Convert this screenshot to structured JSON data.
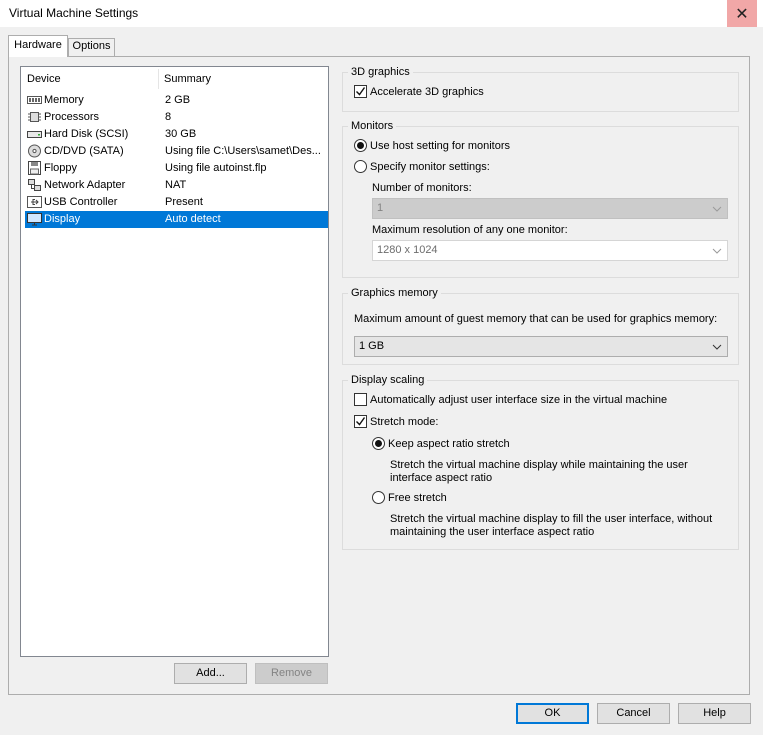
{
  "window": {
    "title": "Virtual Machine Settings"
  },
  "tabs": [
    {
      "label": "Hardware",
      "active": true
    },
    {
      "label": "Options",
      "active": false
    }
  ],
  "device_list": {
    "columns": [
      "Device",
      "Summary"
    ],
    "rows": [
      {
        "device": "Memory",
        "summary": "2 GB",
        "icon": "memory-icon"
      },
      {
        "device": "Processors",
        "summary": "8",
        "icon": "processor-icon"
      },
      {
        "device": "Hard Disk (SCSI)",
        "summary": "30 GB",
        "icon": "hard-disk-icon"
      },
      {
        "device": "CD/DVD (SATA)",
        "summary": "Using file C:\\Users\\samet\\Des...",
        "icon": "cd-dvd-icon"
      },
      {
        "device": "Floppy",
        "summary": "Using file autoinst.flp",
        "icon": "floppy-icon"
      },
      {
        "device": "Network Adapter",
        "summary": "NAT",
        "icon": "network-adapter-icon"
      },
      {
        "device": "USB Controller",
        "summary": "Present",
        "icon": "usb-icon"
      },
      {
        "device": "Display",
        "summary": "Auto detect",
        "icon": "display-icon",
        "selected": true
      }
    ],
    "add_label": "Add...",
    "remove_label": "Remove"
  },
  "graphics3d": {
    "group": "3D graphics",
    "accelerate_label": "Accelerate 3D graphics",
    "accelerate_checked": true
  },
  "monitors": {
    "group": "Monitors",
    "use_host_label": "Use host setting for monitors",
    "specify_label": "Specify monitor settings:",
    "selected": "use_host",
    "num_label": "Number of monitors:",
    "num_value": "1",
    "res_label": "Maximum resolution of any one monitor:",
    "res_value": "1280 x 1024"
  },
  "graphics_memory": {
    "group": "Graphics memory",
    "desc": "Maximum amount of guest memory that can be used for graphics memory:",
    "value": "1 GB"
  },
  "display_scaling": {
    "group": "Display scaling",
    "auto_adjust_label": "Automatically adjust user interface size in the virtual machine",
    "auto_adjust_checked": false,
    "stretch_label": "Stretch mode:",
    "stretch_checked": true,
    "keep_label": "Keep aspect ratio stretch",
    "keep_desc_1": "Stretch the virtual machine display while maintaining the user",
    "keep_desc_2": "interface aspect ratio",
    "free_label": "Free stretch",
    "free_desc_1": "Stretch the virtual machine display to fill the user interface, without",
    "free_desc_2": "maintaining the user interface aspect ratio",
    "selected": "keep"
  },
  "footer": {
    "ok": "OK",
    "cancel": "Cancel",
    "help": "Help"
  },
  "colors": {
    "selection": "#0078d7",
    "close_hover": "#f1a7a7"
  }
}
